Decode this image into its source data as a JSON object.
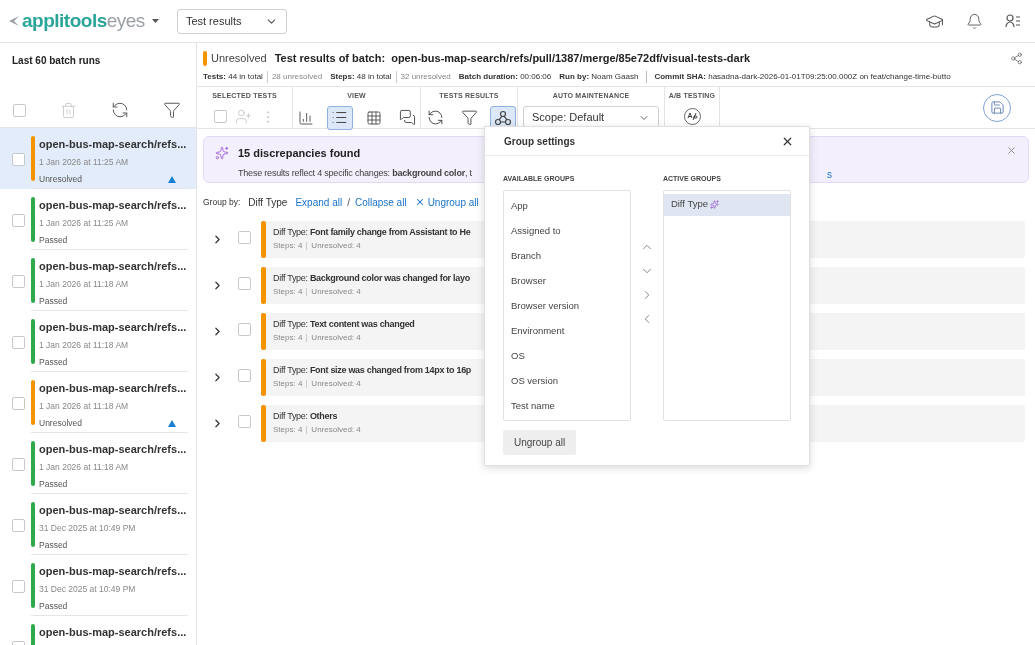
{
  "header": {
    "logo": {
      "brand": "applitools",
      "product": "eyes"
    },
    "view_select": {
      "value": "Test results"
    }
  },
  "sidebar": {
    "title": "Last 60 batch runs",
    "tools": [
      {
        "kind": "checkbox",
        "checked": false
      },
      {
        "kind": "trash",
        "disabled": true
      },
      {
        "kind": "refresh",
        "disabled": false
      },
      {
        "kind": "filter",
        "disabled": false
      }
    ],
    "batches": [
      {
        "name": "open-bus-map-search/refs...",
        "date": "1 Jan 2026 at 11:25 AM",
        "status": "Unresolved",
        "color": "#f59300",
        "selected": true,
        "checked": false,
        "flagged": true
      },
      {
        "name": "open-bus-map-search/refs...",
        "date": "1 Jan 2026 at 11:25 AM",
        "status": "Passed",
        "color": "#2eaa4a",
        "selected": false,
        "checked": false,
        "flagged": false
      },
      {
        "name": "open-bus-map-search/refs...",
        "date": "1 Jan 2026 at 11:18 AM",
        "status": "Passed",
        "color": "#2eaa4a",
        "selected": false,
        "checked": false,
        "flagged": false
      },
      {
        "name": "open-bus-map-search/refs...",
        "date": "1 Jan 2026 at 11:18 AM",
        "status": "Passed",
        "color": "#2eaa4a",
        "selected": false,
        "checked": false,
        "flagged": false
      },
      {
        "name": "open-bus-map-search/refs...",
        "date": "1 Jan 2026 at 11:18 AM",
        "status": "Unresolved",
        "color": "#f59300",
        "selected": false,
        "checked": false,
        "flagged": true
      },
      {
        "name": "open-bus-map-search/refs...",
        "date": "1 Jan 2026 at 11:18 AM",
        "status": "Passed",
        "color": "#2eaa4a",
        "selected": false,
        "checked": false,
        "flagged": false
      },
      {
        "name": "open-bus-map-search/refs...",
        "date": "31 Dec 2025 at 10:49 PM",
        "status": "Passed",
        "color": "#2eaa4a",
        "selected": false,
        "checked": false,
        "flagged": false
      },
      {
        "name": "open-bus-map-search/refs...",
        "date": "31 Dec 2025 at 10:49 PM",
        "status": "Passed",
        "color": "#2eaa4a",
        "selected": false,
        "checked": false,
        "flagged": false
      },
      {
        "name": "open-bus-map-search/refs...",
        "color": "#2eaa4a",
        "selected": false,
        "checked": false
      }
    ]
  },
  "batch": {
    "status": "Unresolved",
    "color": "#f59300",
    "title": "Test results of batch:  open-bus-map-search/refs/pull/1387/merge/85e72df/visual-tests-dark",
    "stats": [
      {
        "text": "**Tests:** 44 in total",
        "extra": "28 unresolved",
        "separated": false
      },
      {
        "text": "**Steps:** 48 in total",
        "extra": "32 unresolved",
        "separated": false
      },
      {
        "text": "**Batch duration:** 00:06:06",
        "separated": false
      },
      {
        "text": "**Run by:** Noam Gaash",
        "separated": false
      },
      {
        "text": "**Commit SHA:** hasadna-dark-2026-01-01T09:25:00.000Z on feat/change-time-butto",
        "separated": true
      }
    ]
  },
  "toolbar": [
    {
      "label": "SELECTED TESTS",
      "tools": [
        {
          "kind": "checkbox",
          "checked": false
        },
        {
          "kind": "assign",
          "disabled": true
        },
        {
          "kind": "more",
          "disabled": true
        }
      ]
    },
    {
      "label": "VIEW",
      "tools": [
        {
          "kind": "chart",
          "selected": false
        },
        {
          "kind": "list",
          "selected": true
        },
        {
          "kind": "grid",
          "selected": false
        },
        {
          "kind": "comments",
          "selected": false
        }
      ]
    },
    {
      "label": "TESTS RESULTS",
      "tools": [
        {
          "kind": "refresh",
          "selected": false
        },
        {
          "kind": "filter",
          "selected": false
        },
        {
          "kind": "group",
          "selected": true
        }
      ]
    },
    {
      "label": "AUTO MAINTENANCE",
      "tools": [
        {
          "kind": "select",
          "value": "Scope: Default"
        }
      ]
    },
    {
      "label": "A/B TESTING",
      "tools": [
        {
          "kind": "ab"
        }
      ]
    }
  ],
  "banner": {
    "title": "15 discrepancies found",
    "text": "These results reflect 4 specific changes: **background color**, t",
    "link": "s"
  },
  "group_by": {
    "label": "Group by:",
    "value": "Diff Type",
    "expand": "Expand all",
    "slash": "/",
    "collapse": "Collapse all",
    "ungroup": "Ungroup all"
  },
  "groups": [
    {
      "title": "Diff Type: **Font family change from Assistant to He**",
      "steps": "Steps: 4",
      "unresolved": "Unresolved: 4",
      "expanded": false,
      "checked": false,
      "color": "#f59300"
    },
    {
      "title": "Diff Type: **Background color was changed for layo**",
      "steps": "Steps: 4",
      "unresolved": "Unresolved: 4",
      "expanded": false,
      "checked": false,
      "color": "#f59300"
    },
    {
      "title": "Diff Type: **Text content was changed**",
      "steps": "Steps: 4",
      "unresolved": "Unresolved: 4",
      "expanded": false,
      "checked": false,
      "color": "#f59300"
    },
    {
      "title": "Diff Type: **Font size was changed from 14px to 16p**",
      "steps": "Steps: 4",
      "unresolved": "Unresolved: 4",
      "expanded": false,
      "checked": false,
      "color": "#f59300"
    },
    {
      "title": "Diff Type: **Others**",
      "steps": "Steps: 4",
      "unresolved": "Unresolved: 4",
      "expanded": false,
      "checked": false,
      "color": "#f59300"
    }
  ],
  "group_settings": {
    "title": "Group settings",
    "available_label": "AVAILABLE GROUPS",
    "available": [
      {
        "label": "App",
        "selected": false
      },
      {
        "label": "Assigned to",
        "selected": false
      },
      {
        "label": "Branch",
        "selected": false
      },
      {
        "label": "Browser",
        "selected": false
      },
      {
        "label": "Browser version",
        "selected": false
      },
      {
        "label": "Environment",
        "selected": false
      },
      {
        "label": "OS",
        "selected": false
      },
      {
        "label": "OS version",
        "selected": false
      },
      {
        "label": "Test name",
        "selected": false
      }
    ],
    "active_label": "ACTIVE GROUPS",
    "active": [
      {
        "label": "Diff Type",
        "selected": true,
        "ai": true
      }
    ],
    "button": "Ungroup all"
  }
}
